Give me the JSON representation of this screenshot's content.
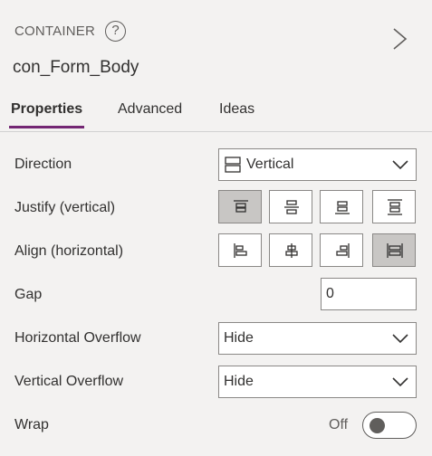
{
  "header": {
    "type_label": "CONTAINER",
    "help_glyph": "?",
    "control_name": "con_Form_Body"
  },
  "tabs": [
    {
      "label": "Properties",
      "active": true
    },
    {
      "label": "Advanced",
      "active": false
    },
    {
      "label": "Ideas",
      "active": false
    }
  ],
  "properties": {
    "direction": {
      "label": "Direction",
      "value": "Vertical",
      "icon": "vertical-layout-icon"
    },
    "justify": {
      "label": "Justify (vertical)",
      "options": [
        "justify-top-icon",
        "justify-center-icon",
        "justify-bottom-icon",
        "justify-space-between-icon"
      ],
      "selected": "justify-top-icon"
    },
    "align": {
      "label": "Align (horizontal)",
      "options": [
        "align-left-icon",
        "align-center-icon",
        "align-right-icon",
        "align-stretch-icon"
      ],
      "selected": "align-stretch-icon"
    },
    "gap": {
      "label": "Gap",
      "value": "0"
    },
    "horizontal_overflow": {
      "label": "Horizontal Overflow",
      "value": "Hide"
    },
    "vertical_overflow": {
      "label": "Vertical Overflow",
      "value": "Hide"
    },
    "wrap": {
      "label": "Wrap",
      "state_label": "Off",
      "on": false
    }
  },
  "colors": {
    "accent": "#742774",
    "panel_bg": "#f3f2f1",
    "selected_bg": "#c8c6c4"
  }
}
